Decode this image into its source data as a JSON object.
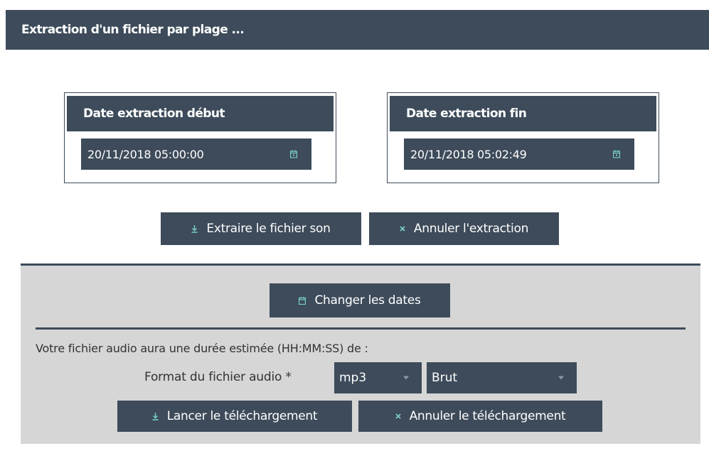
{
  "header": {
    "title": "Extraction d'un fichier par plage ..."
  },
  "start": {
    "label": "Date extraction début",
    "value": "20/11/2018 05:00:00",
    "icon": "calendar-icon"
  },
  "end": {
    "label": "Date extraction fin",
    "value": "20/11/2018 05:02:49",
    "icon": "calendar-icon"
  },
  "actions": {
    "extract_label": "Extraire le fichier son",
    "extract_icon": "download-icon",
    "cancel_extract_label": "Annuler l'extraction",
    "cancel_extract_icon": "close-icon"
  },
  "lower": {
    "change_dates_label": "Changer les dates",
    "change_dates_icon": "calendar-icon",
    "estimate_text": "Votre fichier audio aura une durée estimée (HH:MM:SS) de :",
    "format_label": "Format du fichier audio",
    "required_mark": "*",
    "format_value": "mp3",
    "quality_value": "Brut",
    "download_label": "Lancer le téléchargement",
    "download_icon": "download-icon",
    "cancel_download_label": "Annuler le téléchargement",
    "cancel_download_icon": "close-icon"
  },
  "colors": {
    "primary": "#3d4b5a",
    "panel_gray": "#d6d6d6",
    "icon_accent": "#7ad3c6"
  }
}
